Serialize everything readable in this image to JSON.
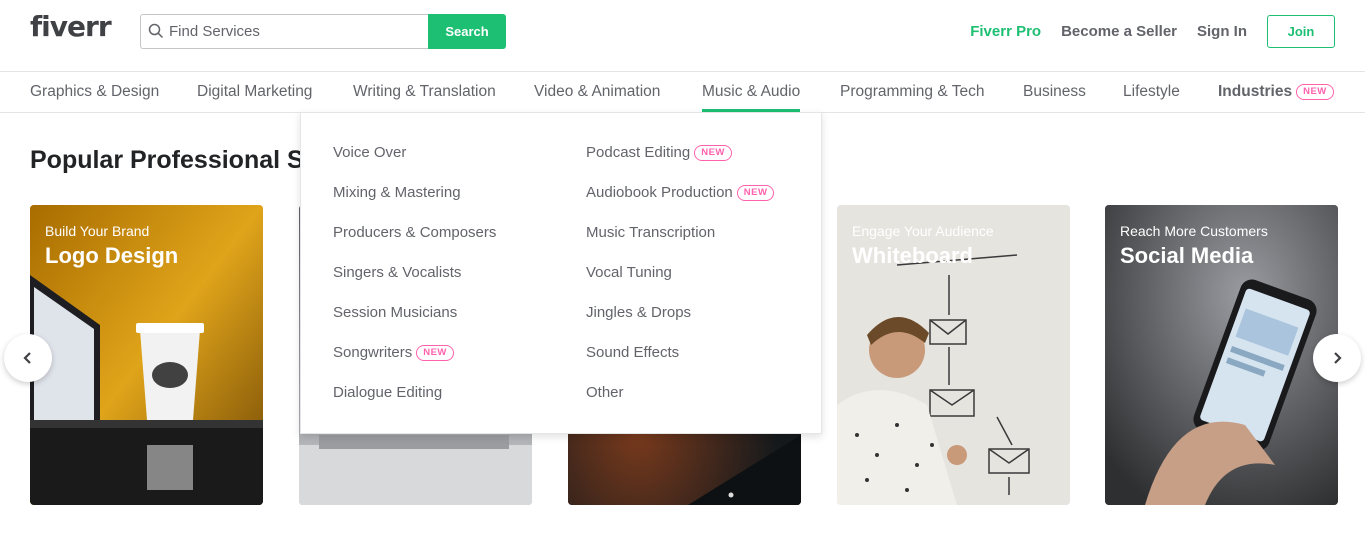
{
  "header": {
    "logo": "fiverr",
    "search": {
      "placeholder": "Find Services",
      "button_label": "Search",
      "icon": "search-icon"
    },
    "links": {
      "pro": "Fiverr Pro",
      "seller": "Become a Seller",
      "signin": "Sign In",
      "join": "Join"
    }
  },
  "colors": {
    "accent": "#1dbf73",
    "badge": "#ff62ad",
    "text": "#62646a"
  },
  "categories": [
    {
      "label": "Graphics & Design"
    },
    {
      "label": "Digital Marketing"
    },
    {
      "label": "Writing & Translation"
    },
    {
      "label": "Video & Animation"
    },
    {
      "label": "Music & Audio",
      "active": true
    },
    {
      "label": "Programming & Tech"
    },
    {
      "label": "Business"
    },
    {
      "label": "Lifestyle"
    },
    {
      "label": "Industries",
      "badge": "NEW"
    }
  ],
  "section": {
    "title": "Popular Professional Services"
  },
  "dropdown": {
    "col1": [
      {
        "label": "Voice Over"
      },
      {
        "label": "Mixing & Mastering"
      },
      {
        "label": "Producers & Composers"
      },
      {
        "label": "Singers & Vocalists"
      },
      {
        "label": "Session Musicians"
      },
      {
        "label": "Songwriters",
        "badge": "NEW"
      },
      {
        "label": "Dialogue Editing"
      }
    ],
    "col2": [
      {
        "label": "Podcast Editing",
        "badge": "NEW"
      },
      {
        "label": "Audiobook Production",
        "badge": "NEW"
      },
      {
        "label": "Music Transcription"
      },
      {
        "label": "Vocal Tuning"
      },
      {
        "label": "Jingles & Drops"
      },
      {
        "label": "Sound Effects"
      },
      {
        "label": "Other"
      }
    ]
  },
  "cards": [
    {
      "subtitle": "Build Your Brand",
      "title": "Logo Design"
    },
    {
      "subtitle": "",
      "title": ""
    },
    {
      "subtitle": "",
      "title": ""
    },
    {
      "subtitle": "Engage Your Audience",
      "title": "Whiteboard"
    },
    {
      "subtitle": "Reach More Customers",
      "title": "Social Media"
    }
  ],
  "carousel": {
    "prev_icon": "chevron-left-icon",
    "next_icon": "chevron-right-icon"
  }
}
